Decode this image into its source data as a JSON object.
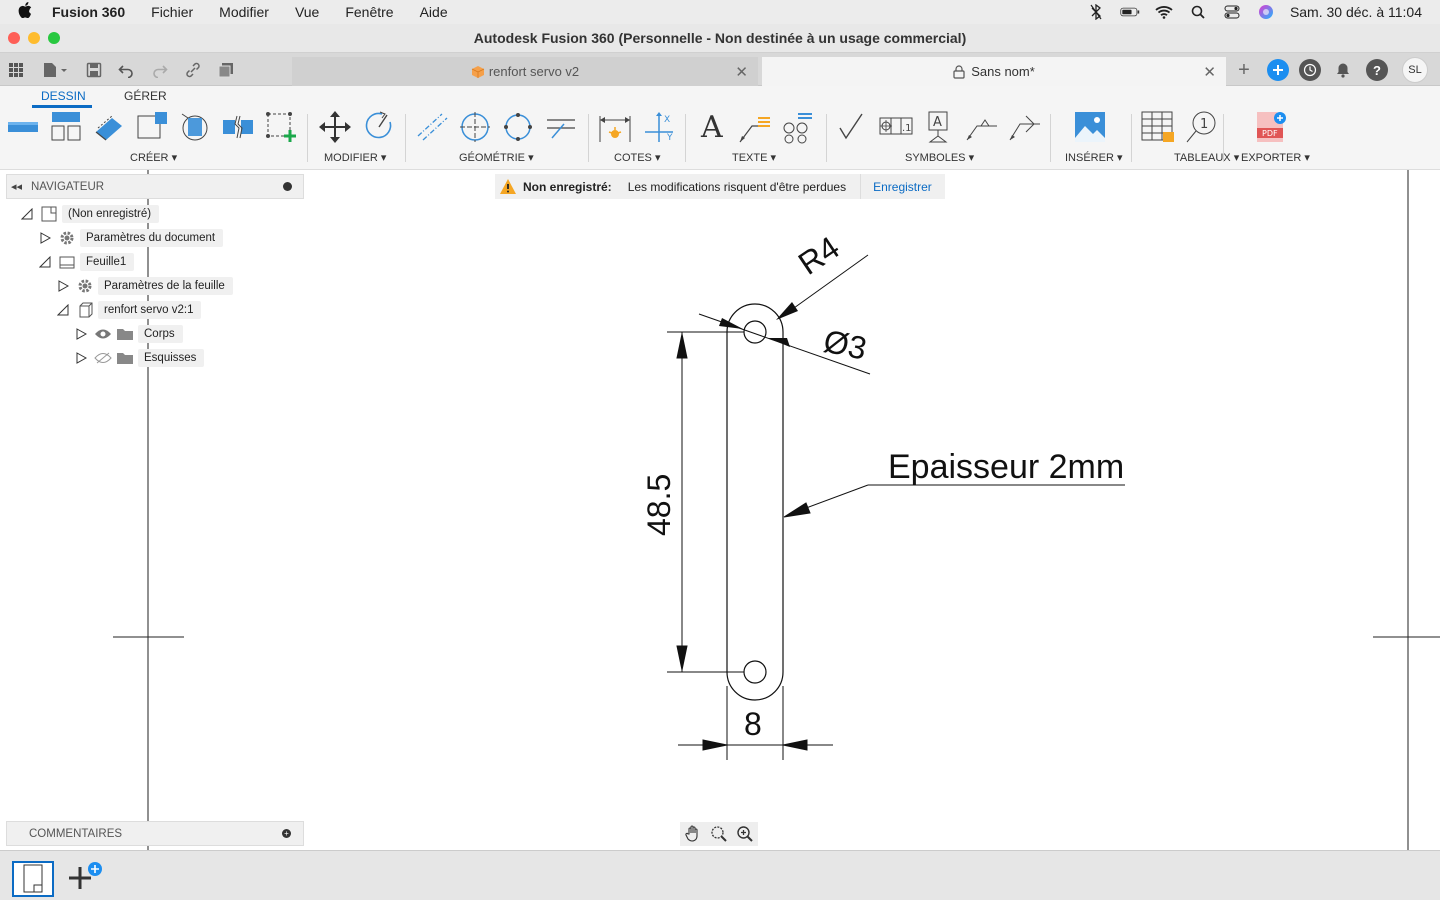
{
  "menubar": {
    "app_name": "Fusion 360",
    "items": [
      "Fichier",
      "Modifier",
      "Vue",
      "Fenêtre",
      "Aide"
    ],
    "datetime": "Sam. 30 déc. à  11:04"
  },
  "window": {
    "title": "Autodesk Fusion 360 (Personnelle - Non destinée à un usage commercial)"
  },
  "tabs": [
    {
      "label": "renfort servo v2",
      "active": false
    },
    {
      "label": "Sans nom*",
      "active": true
    }
  ],
  "user_initials": "SL",
  "ribbon": {
    "tabs": [
      "DESSIN",
      "GÉRER"
    ],
    "groups": {
      "creer": "CRÉER",
      "modifier": "MODIFIER",
      "geometrie": "GÉOMÉTRIE",
      "cotes": "COTES",
      "texte": "TEXTE",
      "symboles": "SYMBOLES",
      "inserer": "INSÉRER",
      "tableaux": "TABLEAUX",
      "exporter": "EXPORTER"
    },
    "text_icon_glyph": "A"
  },
  "navigator": {
    "title": "NAVIGATEUR",
    "items": [
      "(Non enregistré)",
      "Paramètres du document",
      "Feuille1",
      "Paramètres de la feuille",
      "renfort servo v2:1",
      "Corps",
      "Esquisses"
    ]
  },
  "warning": {
    "title": "Non enregistré:",
    "message": "Les modifications risquent d'être perdues",
    "action": "Enregistrer"
  },
  "comments": {
    "title": "COMMENTAIRES"
  },
  "drawing": {
    "dim_radius": "R4",
    "dim_diameter": "Ø3",
    "dim_length": "48.5",
    "dim_width": "8",
    "note": "Epaisseur 2mm"
  },
  "colors": {
    "accent": "#0b6bc4",
    "warning": "#f5a623"
  }
}
